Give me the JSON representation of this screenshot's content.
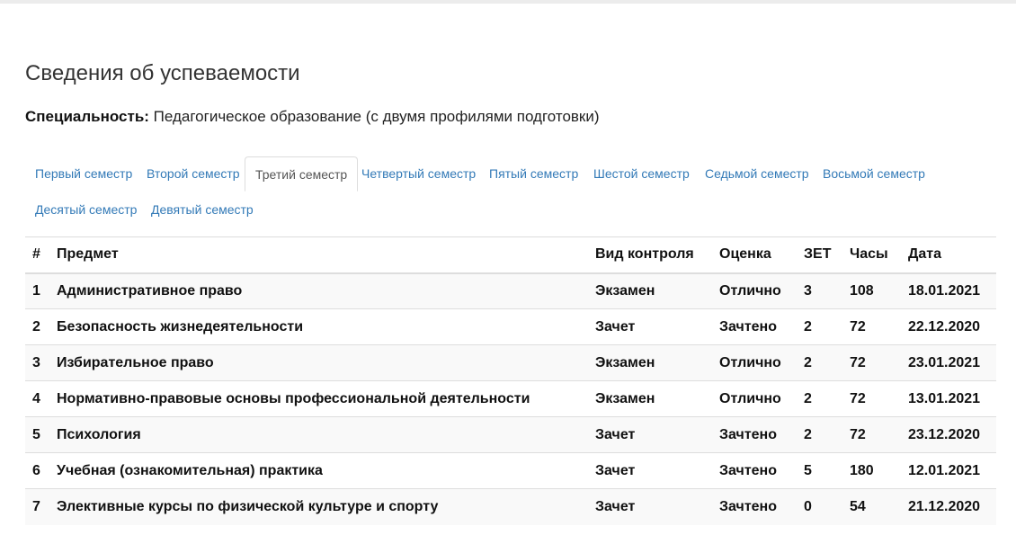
{
  "page": {
    "title": "Сведения об успеваемости",
    "specialty_label": "Специальность:",
    "specialty_value": "Педагогическое образование (с двумя профилями подготовки)"
  },
  "tabs": [
    {
      "label": "Первый семестр",
      "active": false
    },
    {
      "label": "Второй семестр",
      "active": false
    },
    {
      "label": "Третий семестр",
      "active": true
    },
    {
      "label": "Четвертый семестр",
      "active": false
    },
    {
      "label": "Пятый семестр",
      "active": false
    },
    {
      "label": "Шестой семестр",
      "active": false
    },
    {
      "label": "Седьмой семестр",
      "active": false
    },
    {
      "label": "Восьмой семестр",
      "active": false
    },
    {
      "label": "Десятый семестр",
      "active": false
    },
    {
      "label": "Девятый семестр",
      "active": false
    }
  ],
  "table": {
    "headers": [
      "#",
      "Предмет",
      "Вид контроля",
      "Оценка",
      "ЗЕТ",
      "Часы",
      "Дата"
    ],
    "rows": [
      {
        "num": "1",
        "subject": "Административное право",
        "control": "Экзамен",
        "grade": "Отлично",
        "zet": "3",
        "hours": "108",
        "date": "18.01.2021"
      },
      {
        "num": "2",
        "subject": "Безопасность жизнедеятельности",
        "control": "Зачет",
        "grade": "Зачтено",
        "zet": "2",
        "hours": "72",
        "date": "22.12.2020"
      },
      {
        "num": "3",
        "subject": "Избирательное право",
        "control": "Экзамен",
        "grade": "Отлично",
        "zet": "2",
        "hours": "72",
        "date": "23.01.2021"
      },
      {
        "num": "4",
        "subject": "Нормативно-правовые основы профессиональной деятельности",
        "control": "Экзамен",
        "grade": "Отлично",
        "zet": "2",
        "hours": "72",
        "date": "13.01.2021"
      },
      {
        "num": "5",
        "subject": "Психология",
        "control": "Зачет",
        "grade": "Зачтено",
        "zet": "2",
        "hours": "72",
        "date": "23.12.2020"
      },
      {
        "num": "6",
        "subject": "Учебная (ознакомительная) практика",
        "control": "Зачет",
        "grade": "Зачтено",
        "zet": "5",
        "hours": "180",
        "date": "12.01.2021"
      },
      {
        "num": "7",
        "subject": "Элективные курсы по физической культуре и спорту",
        "control": "Зачет",
        "grade": "Зачтено",
        "zet": "0",
        "hours": "54",
        "date": "21.12.2020"
      }
    ]
  },
  "colors": {
    "tab_link": "#337ab7",
    "tab_active_text": "#555555",
    "stripe": "#f9f9f9",
    "border": "#dddddd"
  }
}
